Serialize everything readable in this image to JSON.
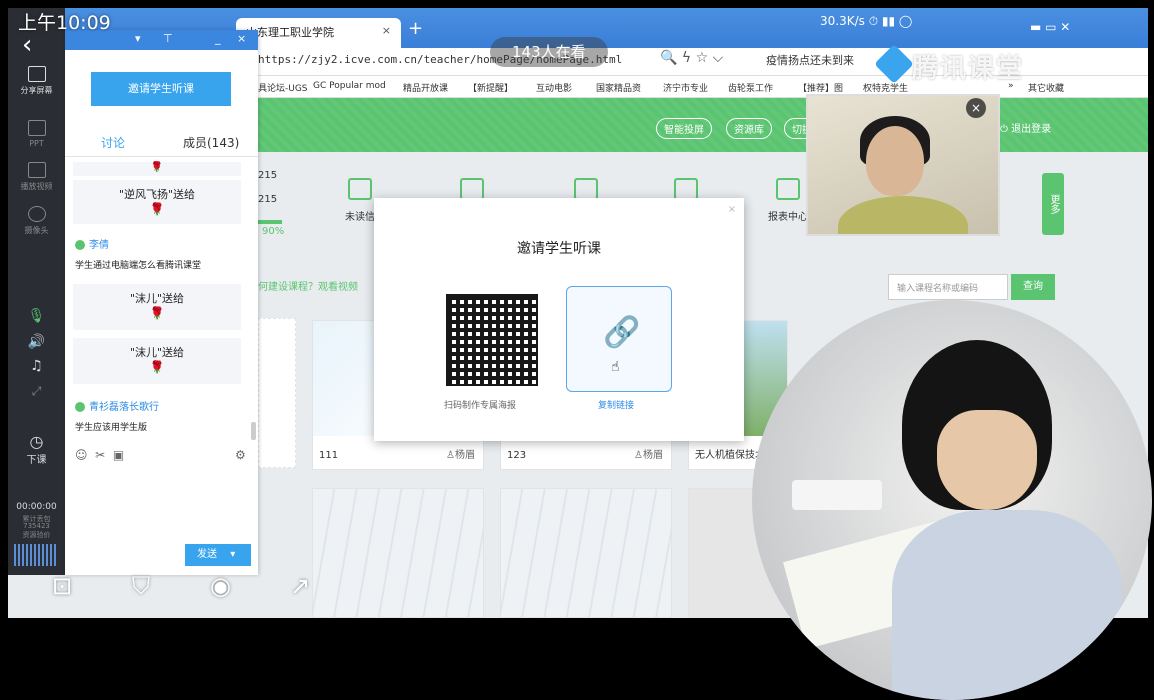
{
  "status": {
    "time": "上午10:09",
    "net": "30.3K/s"
  },
  "live": {
    "viewers": "143人在看",
    "brand": "腾讯课堂"
  },
  "browser": {
    "tab_title": "山东理工职业学院",
    "url": "https://zjy2.icve.com.cn/teacher/homePage/homePage.html",
    "warning": "疫情扬点还未到来",
    "bookmarks": [
      "具论坛-UGS",
      "GC Popular mod",
      "精品开放课",
      "【新提醒】",
      "互动电影",
      "国家精品资",
      "济宁市专业",
      "齿轮泵工作",
      "【推荐】图",
      "权特克学生",
      "»",
      "其它收藏"
    ]
  },
  "site": {
    "pills": [
      "智能投屏",
      "资源库",
      "切换"
    ],
    "logout": "退出登录",
    "stats": [
      "215",
      "215",
      "90%"
    ],
    "tiles": [
      "未读信",
      "",
      "",
      "",
      "报表中心",
      "",
      "统计"
    ],
    "build_link": "何建设课程？观看视频",
    "search_placeholder": "输入课程名称或编码",
    "search_button": "查询",
    "more": "更多",
    "cards": [
      {
        "title": "111",
        "author": "杨眉"
      },
      {
        "title": "123",
        "author": "杨眉"
      },
      {
        "title": "无人机植保技术",
        "author": ""
      }
    ]
  },
  "modal": {
    "title": "邀请学生听课",
    "qr_label": "扫码制作专属海报",
    "copy_label": "复制链接"
  },
  "left_toolbar": {
    "items": [
      "分享屏幕",
      "PPT",
      "播放视频",
      "摄像头",
      "下课"
    ],
    "timer": "00:00:00",
    "stats": [
      "累计丢包",
      "735423",
      "资源验价"
    ]
  },
  "chat": {
    "invite_button": "邀请学生听课",
    "tab_discuss": "讨论",
    "tab_members": "成员(143)",
    "gifts": [
      "\"逆风飞扬\"送给",
      "\"沫儿\"送给",
      "\"沫儿\"送给"
    ],
    "messages": [
      {
        "user": "李倩",
        "text": "学生通过电脑端怎么看腾讯课堂"
      },
      {
        "user": "青衫磊落长歌行",
        "text": "学生应该用学生版"
      }
    ],
    "send_button": "发送"
  }
}
